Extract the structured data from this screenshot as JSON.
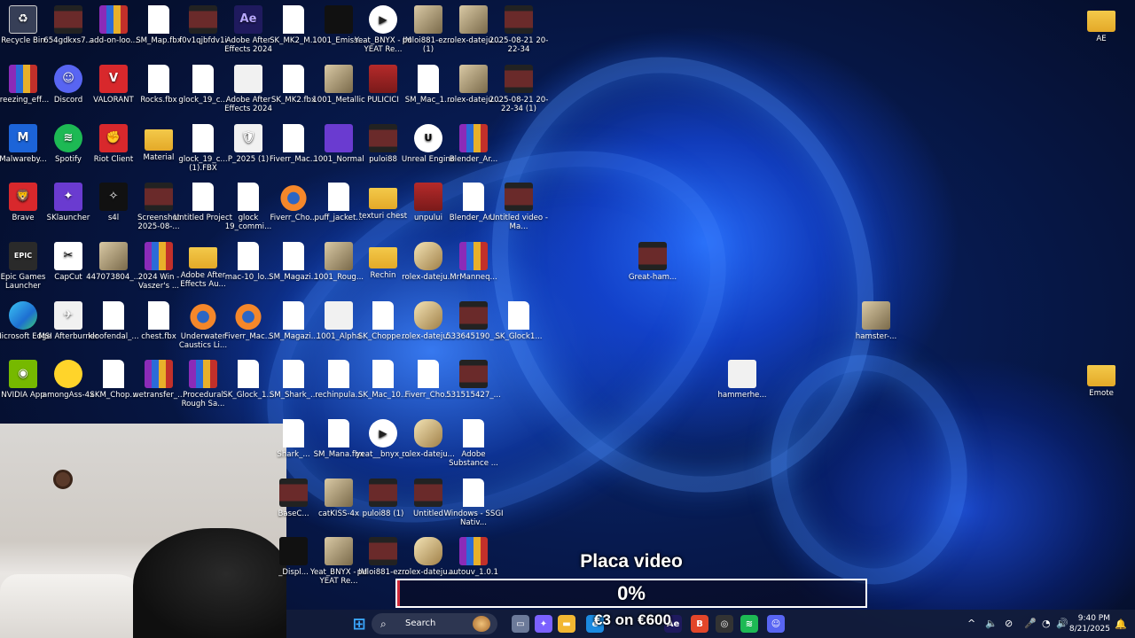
{
  "desktop_icons": [
    {
      "label": "Recycle Bin",
      "icon": "recycle-bin-icon",
      "style": "g-bin",
      "glyph": "♻"
    },
    {
      "label": "654gdkxs7...",
      "icon": "video-file-icon",
      "style": "g-film",
      "glyph": ""
    },
    {
      "label": "add-on-loo...",
      "icon": "winrar-icon",
      "style": "g-rar",
      "glyph": ""
    },
    {
      "label": "SM_Map.fbx",
      "icon": "document-icon",
      "style": "g-doc",
      "glyph": ""
    },
    {
      "label": "f0v1qjbfdv1i",
      "icon": "video-file-icon",
      "style": "g-film",
      "glyph": ""
    },
    {
      "label": "Adobe After Effects 2024",
      "icon": "after-effects-icon",
      "style": "g-ae",
      "glyph": "Ae"
    },
    {
      "label": "SK_MK2_M...",
      "icon": "document-icon",
      "style": "g-doc",
      "glyph": ""
    },
    {
      "label": "1001_Emiss...",
      "icon": "image-file-icon",
      "style": "g-dark",
      "glyph": ""
    },
    {
      "label": "Yeat_BNYX - IM YEAT Re...",
      "icon": "media-file-icon",
      "style": "g-video",
      "glyph": "▶"
    },
    {
      "label": "puloi881-ez... (1)",
      "icon": "image-file-icon",
      "style": "g-img",
      "glyph": ""
    },
    {
      "label": "rolex-dateju...",
      "icon": "image-file-icon",
      "style": "g-img",
      "glyph": ""
    },
    {
      "label": "2025-08-21 20-22-34",
      "icon": "video-file-icon",
      "style": "g-film",
      "glyph": ""
    },
    {
      "label": "freezing_eff...",
      "icon": "winrar-icon",
      "style": "g-rar",
      "glyph": ""
    },
    {
      "label": "Discord",
      "icon": "discord-icon",
      "style": "g-disc",
      "glyph": "☺"
    },
    {
      "label": "VALORANT",
      "icon": "valorant-icon",
      "style": "g-red",
      "glyph": "V"
    },
    {
      "label": "Rocks.fbx",
      "icon": "document-icon",
      "style": "g-doc",
      "glyph": ""
    },
    {
      "label": "glock_19_c...",
      "icon": "document-icon",
      "style": "g-doc",
      "glyph": ""
    },
    {
      "label": "Adobe After Effects 2024",
      "icon": "after-effects-file-icon",
      "style": "g-white",
      "glyph": ""
    },
    {
      "label": "SK_MK2.fbx",
      "icon": "document-icon",
      "style": "g-doc",
      "glyph": ""
    },
    {
      "label": "1001_Metallic",
      "icon": "image-file-icon",
      "style": "g-img",
      "glyph": ""
    },
    {
      "label": "PULICICI",
      "icon": "image-file-icon",
      "style": "g-pcb",
      "glyph": ""
    },
    {
      "label": "SM_Mac_1...",
      "icon": "document-icon",
      "style": "g-doc",
      "glyph": ""
    },
    {
      "label": "rolex-dateju...",
      "icon": "image-file-icon",
      "style": "g-img",
      "glyph": ""
    },
    {
      "label": "2025-08-21 20-22-34 (1)",
      "icon": "video-file-icon",
      "style": "g-film",
      "glyph": ""
    },
    {
      "label": "Malwareby...",
      "icon": "malwarebytes-icon",
      "style": "g-blue",
      "glyph": "M"
    },
    {
      "label": "Spotify",
      "icon": "spotify-icon",
      "style": "g-green",
      "glyph": "≋"
    },
    {
      "label": "Riot Client",
      "icon": "riot-client-icon",
      "style": "g-red",
      "glyph": "✊"
    },
    {
      "label": "Material",
      "icon": "folder-icon",
      "style": "g-folder",
      "glyph": ""
    },
    {
      "label": "glock_19_c... (1).FBX",
      "icon": "document-icon",
      "style": "g-doc",
      "glyph": ""
    },
    {
      "label": "P_2025 (1)",
      "icon": "brave-file-icon",
      "style": "g-white",
      "glyph": "🛡"
    },
    {
      "label": "Fiverr_Mac...",
      "icon": "document-icon",
      "style": "g-doc",
      "glyph": ""
    },
    {
      "label": "1001_Normal",
      "icon": "image-file-icon",
      "style": "g-purple",
      "glyph": ""
    },
    {
      "label": "puloi88",
      "icon": "image-file-icon",
      "style": "g-film",
      "glyph": ""
    },
    {
      "label": "Unreal Engine",
      "icon": "unreal-engine-icon",
      "style": "g-unreal",
      "glyph": "U"
    },
    {
      "label": "Blender_Ar...",
      "icon": "winrar-icon",
      "style": "g-rar",
      "glyph": ""
    },
    {
      "label": "Brave",
      "icon": "brave-icon",
      "style": "g-red",
      "glyph": "🦁"
    },
    {
      "label": "SKlauncher",
      "icon": "sklauncher-icon",
      "style": "g-purple",
      "glyph": "✦"
    },
    {
      "label": "s4l",
      "icon": "app-icon",
      "style": "g-dark",
      "glyph": "✧"
    },
    {
      "label": "Screenshot 2025-08-...",
      "icon": "image-file-icon",
      "style": "g-film",
      "glyph": ""
    },
    {
      "label": "Untitled Project",
      "icon": "document-icon",
      "style": "g-doc",
      "glyph": ""
    },
    {
      "label": "glock 19_commi...",
      "icon": "document-icon",
      "style": "g-doc",
      "glyph": ""
    },
    {
      "label": "Fiverr_Cho...",
      "icon": "blender-icon",
      "style": "g-blend",
      "glyph": ""
    },
    {
      "label": "puff_jacket...",
      "icon": "document-icon",
      "style": "g-doc",
      "glyph": ""
    },
    {
      "label": "texturi chest",
      "icon": "folder-icon",
      "style": "g-folder",
      "glyph": ""
    },
    {
      "label": "unpului",
      "icon": "image-file-icon",
      "style": "g-pcb",
      "glyph": ""
    },
    {
      "label": "Blender_Ar...",
      "icon": "document-icon",
      "style": "g-doc",
      "glyph": ""
    },
    {
      "label": "Untitled video - Ma...",
      "icon": "video-file-icon",
      "style": "g-film",
      "glyph": ""
    },
    {
      "label": "Epic Games Launcher",
      "icon": "epic-games-icon",
      "style": "g-epic",
      "glyph": "EPIC"
    },
    {
      "label": "CapCut",
      "icon": "capcut-icon",
      "style": "g-capcut",
      "glyph": "✂"
    },
    {
      "label": "447073804_...",
      "icon": "image-file-icon",
      "style": "g-img",
      "glyph": ""
    },
    {
      "label": "2024 Win - Vaszer's ...",
      "icon": "winrar-icon",
      "style": "g-rar",
      "glyph": ""
    },
    {
      "label": "Adobe After Effects Au...",
      "icon": "folder-icon",
      "style": "g-folder",
      "glyph": ""
    },
    {
      "label": "mac-10_lo...",
      "icon": "document-icon",
      "style": "g-doc",
      "glyph": ""
    },
    {
      "label": "SM_Magazi...",
      "icon": "document-icon",
      "style": "g-doc",
      "glyph": ""
    },
    {
      "label": "1001_Roug...",
      "icon": "image-file-icon",
      "style": "g-img",
      "glyph": ""
    },
    {
      "label": "Rechin",
      "icon": "folder-icon",
      "style": "g-folder",
      "glyph": ""
    },
    {
      "label": "rolex-dateju...",
      "icon": "image-file-icon",
      "style": "g-rolex",
      "glyph": ""
    },
    {
      "label": "MrManneq...",
      "icon": "winrar-icon",
      "style": "g-rar",
      "glyph": ""
    },
    {
      "label": "Great-ham...",
      "icon": "image-file-icon",
      "style": "g-film",
      "glyph": ""
    },
    {
      "label": "Microsoft Edge",
      "icon": "edge-icon",
      "style": "g-edge",
      "glyph": ""
    },
    {
      "label": "MSI Afterburner",
      "icon": "msi-afterburner-icon",
      "style": "g-white",
      "glyph": "✈"
    },
    {
      "label": "kloofendal_...",
      "icon": "document-icon",
      "style": "g-doc",
      "glyph": ""
    },
    {
      "label": "chest.fbx",
      "icon": "document-icon",
      "style": "g-doc",
      "glyph": ""
    },
    {
      "label": "Underwater Caustics Li...",
      "icon": "blender-icon",
      "style": "g-blend",
      "glyph": ""
    },
    {
      "label": "Fiverr_Mac...",
      "icon": "blender-icon",
      "style": "g-blend",
      "glyph": ""
    },
    {
      "label": "SM_Magazi...",
      "icon": "document-icon",
      "style": "g-doc",
      "glyph": ""
    },
    {
      "label": "1001_Alpha",
      "icon": "image-file-icon",
      "style": "g-white",
      "glyph": ""
    },
    {
      "label": "SK_Choppe...",
      "icon": "document-icon",
      "style": "g-doc",
      "glyph": ""
    },
    {
      "label": "rolex-dateju...",
      "icon": "image-file-icon",
      "style": "g-rolex",
      "glyph": ""
    },
    {
      "label": "533645190_...",
      "icon": "image-file-icon",
      "style": "g-film",
      "glyph": ""
    },
    {
      "label": "SK_Glock1...",
      "icon": "document-icon",
      "style": "g-doc",
      "glyph": ""
    },
    {
      "label": "hamster-...",
      "icon": "image-file-icon",
      "style": "g-img",
      "glyph": ""
    },
    {
      "label": "NVIDIA App",
      "icon": "nvidia-icon",
      "style": "g-nvidia",
      "glyph": "◉"
    },
    {
      "label": "amongAss-4x",
      "icon": "image-file-icon",
      "style": "g-yellow",
      "glyph": ""
    },
    {
      "label": "SKM_Chop...",
      "icon": "document-icon",
      "style": "g-doc",
      "glyph": ""
    },
    {
      "label": "wetransfer_...",
      "icon": "winrar-icon",
      "style": "g-rar",
      "glyph": ""
    },
    {
      "label": "Procedural Rough Sa...",
      "icon": "winrar-icon",
      "style": "g-rar",
      "glyph": ""
    },
    {
      "label": "SK_Glock_1...",
      "icon": "document-icon",
      "style": "g-doc",
      "glyph": ""
    },
    {
      "label": "SM_Shark_...",
      "icon": "document-icon",
      "style": "g-doc",
      "glyph": ""
    },
    {
      "label": "rechinpula...",
      "icon": "document-icon",
      "style": "g-doc",
      "glyph": ""
    },
    {
      "label": "SK_Mac_10...",
      "icon": "document-icon",
      "style": "g-doc",
      "glyph": ""
    },
    {
      "label": "Fiverr_Cho...",
      "icon": "document-icon",
      "style": "g-doc",
      "glyph": ""
    },
    {
      "label": "531515427_...",
      "icon": "image-file-icon",
      "style": "g-film",
      "glyph": ""
    },
    {
      "label": "hammerhe...",
      "icon": "image-file-icon",
      "style": "g-white",
      "glyph": ""
    },
    {
      "label": "Shark_...",
      "icon": "document-icon",
      "style": "g-doc",
      "glyph": ""
    },
    {
      "label": "SM_Mana.fbx",
      "icon": "document-icon",
      "style": "g-doc",
      "glyph": ""
    },
    {
      "label": "yeat__bnyx_...",
      "icon": "media-file-icon",
      "style": "g-video",
      "glyph": "▶"
    },
    {
      "label": "rolex-dateju...",
      "icon": "image-file-icon",
      "style": "g-rolex",
      "glyph": ""
    },
    {
      "label": "Adobe Substance ...",
      "icon": "document-icon",
      "style": "g-doc",
      "glyph": ""
    },
    {
      "label": "BaseC...",
      "icon": "image-file-icon",
      "style": "g-film",
      "glyph": ""
    },
    {
      "label": "catKISS-4x",
      "icon": "image-file-icon",
      "style": "g-img",
      "glyph": ""
    },
    {
      "label": "puloi88 (1)",
      "icon": "image-file-icon",
      "style": "g-film",
      "glyph": ""
    },
    {
      "label": "Untitled",
      "icon": "image-file-icon",
      "style": "g-film",
      "glyph": ""
    },
    {
      "label": "Windows - SSGI Nativ...",
      "icon": "document-icon",
      "style": "g-doc",
      "glyph": ""
    },
    {
      "label": "_Displ...",
      "icon": "image-file-icon",
      "style": "g-dark",
      "glyph": ""
    },
    {
      "label": "Yeat_BNYX - IM YEAT Re...",
      "icon": "image-file-icon",
      "style": "g-img",
      "glyph": ""
    },
    {
      "label": "puloi881-ez...",
      "icon": "image-file-icon",
      "style": "g-film",
      "glyph": ""
    },
    {
      "label": "rolex-dateju...",
      "icon": "image-file-icon",
      "style": "g-rolex",
      "glyph": ""
    },
    {
      "label": "autouv_1.0.1",
      "icon": "winrar-icon",
      "style": "g-rar",
      "glyph": ""
    },
    {
      "label": "AE",
      "icon": "folder-icon",
      "style": "g-folder",
      "glyph": ""
    },
    {
      "label": "Emote",
      "icon": "folder-icon",
      "style": "g-folder",
      "glyph": ""
    }
  ],
  "overlay": {
    "title": "Placa video",
    "progress_text": "0%",
    "progress": 0.0,
    "price_text": "€3 on €600"
  },
  "taskbar": {
    "search_placeholder": "Search",
    "time": "9:40 PM",
    "date": "8/21/2025",
    "apps": [
      {
        "name": "windows-start-icon",
        "glyph": "⊞",
        "color": "#3ba7ff"
      },
      {
        "name": "task-view-icon",
        "glyph": "▭",
        "color": "#6c7a99"
      },
      {
        "name": "copilot-icon",
        "glyph": "✦",
        "color": "#7b61ff"
      },
      {
        "name": "file-explorer-icon",
        "glyph": "▬",
        "color": "#f2b732"
      },
      {
        "name": "edge-taskbar-icon",
        "glyph": "e",
        "color": "#1b8ae0"
      },
      {
        "name": "after-effects-taskbar-icon",
        "glyph": "Ae",
        "color": "#1f1a5e"
      },
      {
        "name": "brave-taskbar-icon",
        "glyph": "B",
        "color": "#e2462a"
      },
      {
        "name": "obs-taskbar-icon",
        "glyph": "◎",
        "color": "#333333"
      },
      {
        "name": "spotify-taskbar-icon",
        "glyph": "≋",
        "color": "#1db954"
      },
      {
        "name": "discord-taskbar-icon",
        "glyph": "☺",
        "color": "#5865f2"
      }
    ],
    "tray": [
      {
        "name": "show-hidden-icons-icon",
        "glyph": "^"
      },
      {
        "name": "speaker-icon",
        "glyph": "🔈"
      },
      {
        "name": "network-off-icon",
        "glyph": "⊘"
      },
      {
        "name": "microphone-icon",
        "glyph": "🎤"
      },
      {
        "name": "wifi-icon",
        "glyph": "◔"
      },
      {
        "name": "volume-icon",
        "glyph": "🔊"
      },
      {
        "name": "notification-icon",
        "glyph": "🔔"
      }
    ]
  },
  "colors": {
    "accent": "#d02a3a",
    "taskbar_bg": "#121c3a"
  }
}
